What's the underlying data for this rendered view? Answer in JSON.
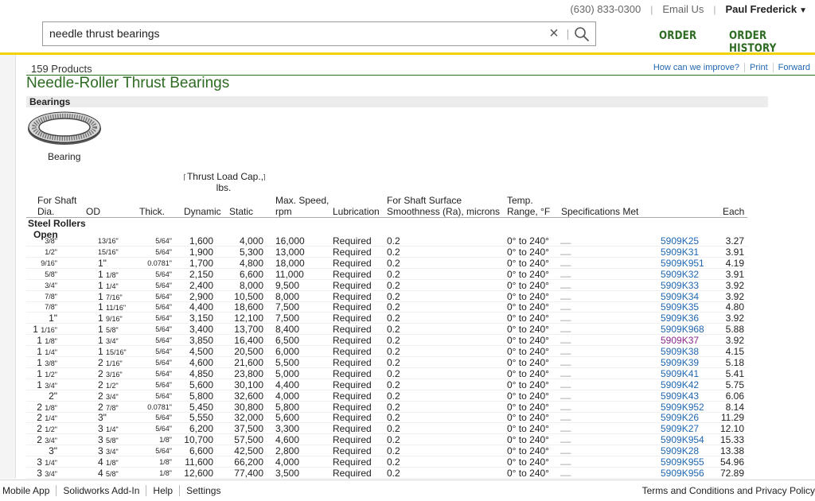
{
  "header": {
    "phone": "(630) 833-0300",
    "email_link": "Email Us",
    "user_name": "Paul Frederick",
    "search_value": "needle thrust bearings",
    "nav_order": "ORDER",
    "nav_order_history": "ORDER HISTORY"
  },
  "content": {
    "product_count": "159 Products",
    "title": "Needle-Roller Thrust Bearings",
    "top_links": [
      "How can we improve?",
      "Print",
      "Forward"
    ],
    "section": "Bearings",
    "image_caption": "Bearing"
  },
  "table": {
    "group_header": "Thrust Load Cap., lbs.",
    "headers": {
      "dia": "For Shaft Dia.",
      "od": "OD",
      "thick": "Thick.",
      "dynamic": "Dynamic",
      "static": "Static",
      "speed": "Max. Speed, rpm",
      "lubrication": "Lubrication",
      "surface": "For Shaft Surface Smoothness (Ra), microns",
      "temp": "Temp. Range, °F",
      "specs": "Specifications Met",
      "each": "Each"
    },
    "group": "Steel Rollers",
    "subgroup": "Open",
    "rows": [
      {
        "dia": "3/8\"",
        "od": "13/16\"",
        "thick": "5/64\"",
        "dynamic": "1,600",
        "static": "4,000",
        "speed": "16,000",
        "lub": "Required",
        "surface": "0.2",
        "temp": "0° to 240°",
        "spec": "__",
        "part": "5909K25",
        "each": "3.27"
      },
      {
        "dia": "1/2\"",
        "od": "15/16\"",
        "thick": "5/64\"",
        "dynamic": "1,900",
        "static": "5,300",
        "speed": "13,000",
        "lub": "Required",
        "surface": "0.2",
        "temp": "0° to 240°",
        "spec": "__",
        "part": "5909K31",
        "each": "3.91"
      },
      {
        "dia": "9/16\"",
        "od": "1\"",
        "thick": "0.0781\"",
        "dynamic": "1,700",
        "static": "4,800",
        "speed": "18,000",
        "lub": "Required",
        "surface": "0.2",
        "temp": "0° to 240°",
        "spec": "__",
        "part": "5909K951",
        "each": "4.19"
      },
      {
        "dia": "5/8\"",
        "od": "1 1/8\"",
        "thick": "5/64\"",
        "dynamic": "2,150",
        "static": "6,600",
        "speed": "11,000",
        "lub": "Required",
        "surface": "0.2",
        "temp": "0° to 240°",
        "spec": "__",
        "part": "5909K32",
        "each": "3.91"
      },
      {
        "dia": "3/4\"",
        "od": "1 1/4\"",
        "thick": "5/64\"",
        "dynamic": "2,400",
        "static": "8,000",
        "speed": "9,500",
        "lub": "Required",
        "surface": "0.2",
        "temp": "0° to 240°",
        "spec": "__",
        "part": "5909K33",
        "each": "3.92"
      },
      {
        "dia": "7/8\"",
        "od": "1 7/16\"",
        "thick": "5/64\"",
        "dynamic": "2,900",
        "static": "10,500",
        "speed": "8,000",
        "lub": "Required",
        "surface": "0.2",
        "temp": "0° to 240°",
        "spec": "__",
        "part": "5909K34",
        "each": "3.92"
      },
      {
        "dia": "7/8\"",
        "od": "1 11/16\"",
        "thick": "5/64\"",
        "dynamic": "4,400",
        "static": "18,600",
        "speed": "7,500",
        "lub": "Required",
        "surface": "0.2",
        "temp": "0° to 240°",
        "spec": "__",
        "part": "5909K35",
        "each": "4.80"
      },
      {
        "dia": "1\"",
        "od": "1 9/16\"",
        "thick": "5/64\"",
        "dynamic": "3,150",
        "static": "12,100",
        "speed": "7,500",
        "lub": "Required",
        "surface": "0.2",
        "temp": "0° to 240°",
        "spec": "__",
        "part": "5909K36",
        "each": "3.92"
      },
      {
        "dia": "1 1/16\"",
        "od": "1 5/8\"",
        "thick": "5/64\"",
        "dynamic": "3,400",
        "static": "13,700",
        "speed": "8,400",
        "lub": "Required",
        "surface": "0.2",
        "temp": "0° to 240°",
        "spec": "__",
        "part": "5909K968",
        "each": "5.88"
      },
      {
        "dia": "1 1/8\"",
        "od": "1 3/4\"",
        "thick": "5/64\"",
        "dynamic": "3,850",
        "static": "16,400",
        "speed": "6,500",
        "lub": "Required",
        "surface": "0.2",
        "temp": "0° to 240°",
        "spec": "__",
        "part": "5909K37",
        "each": "3.92",
        "visited": true
      },
      {
        "dia": "1 1/4\"",
        "od": "1 15/16\"",
        "thick": "5/64\"",
        "dynamic": "4,500",
        "static": "20,500",
        "speed": "6,000",
        "lub": "Required",
        "surface": "0.2",
        "temp": "0° to 240°",
        "spec": "__",
        "part": "5909K38",
        "each": "4.15"
      },
      {
        "dia": "1 3/8\"",
        "od": "2 1/16\"",
        "thick": "5/64\"",
        "dynamic": "4,600",
        "static": "21,600",
        "speed": "5,500",
        "lub": "Required",
        "surface": "0.2",
        "temp": "0° to 240°",
        "spec": "__",
        "part": "5909K39",
        "each": "5.18"
      },
      {
        "dia": "1 1/2\"",
        "od": "2 3/16\"",
        "thick": "5/64\"",
        "dynamic": "4,850",
        "static": "23,800",
        "speed": "5,000",
        "lub": "Required",
        "surface": "0.2",
        "temp": "0° to 240°",
        "spec": "__",
        "part": "5909K41",
        "each": "5.41"
      },
      {
        "dia": "1 3/4\"",
        "od": "2 1/2\"",
        "thick": "5/64\"",
        "dynamic": "5,600",
        "static": "30,100",
        "speed": "4,400",
        "lub": "Required",
        "surface": "0.2",
        "temp": "0° to 240°",
        "spec": "__",
        "part": "5909K42",
        "each": "5.75"
      },
      {
        "dia": "2\"",
        "od": "2 3/4\"",
        "thick": "5/64\"",
        "dynamic": "5,800",
        "static": "32,600",
        "speed": "4,000",
        "lub": "Required",
        "surface": "0.2",
        "temp": "0° to 240°",
        "spec": "__",
        "part": "5909K43",
        "each": "6.06"
      },
      {
        "dia": "2 1/8\"",
        "od": "2 7/8\"",
        "thick": "0.0781\"",
        "dynamic": "5,450",
        "static": "30,800",
        "speed": "5,800",
        "lub": "Required",
        "surface": "0.2",
        "temp": "0° to 240°",
        "spec": "__",
        "part": "5909K952",
        "each": "8.14"
      },
      {
        "dia": "2 1/4\"",
        "od": "3\"",
        "thick": "5/64\"",
        "dynamic": "5,550",
        "static": "32,000",
        "speed": "5,600",
        "lub": "Required",
        "surface": "0.2",
        "temp": "0° to 240°",
        "spec": "__",
        "part": "5909K26",
        "each": "11.29"
      },
      {
        "dia": "2 1/2\"",
        "od": "3 1/4\"",
        "thick": "5/64\"",
        "dynamic": "6,200",
        "static": "37,500",
        "speed": "3,300",
        "lub": "Required",
        "surface": "0.2",
        "temp": "0° to 240°",
        "spec": "__",
        "part": "5909K27",
        "each": "12.10"
      },
      {
        "dia": "2 3/4\"",
        "od": "3 5/8\"",
        "thick": "1/8\"",
        "dynamic": "10,700",
        "static": "57,500",
        "speed": "4,600",
        "lub": "Required",
        "surface": "0.2",
        "temp": "0° to 240°",
        "spec": "__",
        "part": "5909K954",
        "each": "15.33"
      },
      {
        "dia": "3\"",
        "od": "3 3/4\"",
        "thick": "5/64\"",
        "dynamic": "6,600",
        "static": "42,500",
        "speed": "2,800",
        "lub": "Required",
        "surface": "0.2",
        "temp": "0° to 240°",
        "spec": "__",
        "part": "5909K28",
        "each": "13.38"
      },
      {
        "dia": "3 1/4\"",
        "od": "4 1/8\"",
        "thick": "1/8\"",
        "dynamic": "11,600",
        "static": "66,200",
        "speed": "4,000",
        "lub": "Required",
        "surface": "0.2",
        "temp": "0° to 240°",
        "spec": "__",
        "part": "5909K955",
        "each": "54.96"
      },
      {
        "dia": "3 3/4\"",
        "od": "4 5/8\"",
        "thick": "1/8\"",
        "dynamic": "12,600",
        "static": "77,400",
        "speed": "3,500",
        "lub": "Required",
        "surface": "0.2",
        "temp": "0° to 240°",
        "spec": "__",
        "part": "5909K956",
        "each": "72.89"
      }
    ]
  },
  "footer": {
    "links": [
      "Mobile App",
      "Solidworks Add-In",
      "Help",
      "Settings"
    ],
    "terms": "Terms and Conditions and Privacy Policy"
  },
  "colors": {
    "brand_green": "#2e6b22",
    "accent_yellow": "#f2d200",
    "link_blue": "#1f66b0",
    "visited_purple": "#8b2a8b"
  },
  "icons": [
    "search-icon",
    "close-icon",
    "chevron-down-icon",
    "bearing-image"
  ]
}
